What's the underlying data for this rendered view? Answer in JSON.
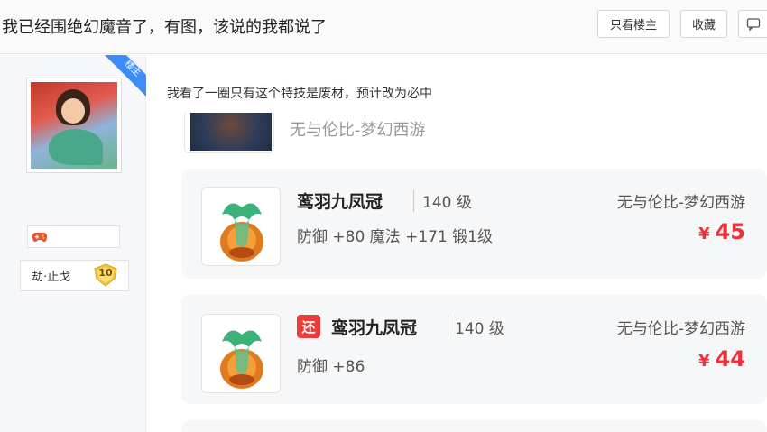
{
  "thread": {
    "title": "我已经围绝幻魔音了，有图，该说的我都说了"
  },
  "toolbar": {
    "only_author_label": "只看楼主",
    "favorite_label": "收藏",
    "reply_icon": "comment-icon"
  },
  "user": {
    "badge_label": "楼主",
    "username": "劫·止戈",
    "level": "10",
    "game_icon": "gamepad-icon"
  },
  "post": {
    "text": "我看了一圈只有这个特技是废材，预计改为必中"
  },
  "partial_item": {
    "server": "无与伦比-梦幻西游"
  },
  "items": [
    {
      "name": "鸾羽九凤冠",
      "level": "140 级",
      "stats": "防御 +80  魔法 +171  锻1级",
      "server": "无与伦比-梦幻西游",
      "currency": "¥",
      "price": "45",
      "tag": ""
    },
    {
      "name": "鸾羽九凤冠",
      "level": "140 级",
      "stats": "防御 +86",
      "server": "无与伦比-梦幻西游",
      "currency": "¥",
      "price": "44",
      "tag": "还"
    }
  ],
  "colors": {
    "price_red": "#f0303a",
    "badge_blue": "#3d8df5",
    "tag_red": "#ee3b3b"
  }
}
